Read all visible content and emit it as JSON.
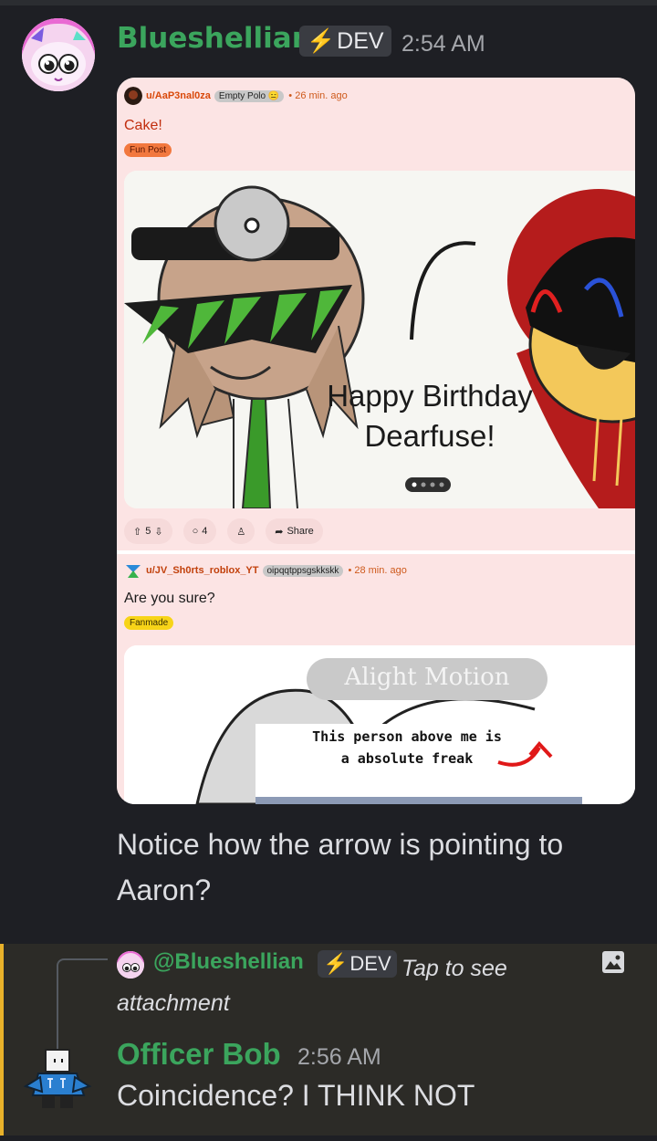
{
  "message1": {
    "author": "Blueshellian",
    "tag": "DEV",
    "time": "2:54 AM",
    "text": "Notice how the arrow is pointing to Aaron?",
    "embed": {
      "post1": {
        "user": "u/AaP3nal0za",
        "user_flair": "Empty Polo 😑",
        "age": "• 26 min. ago",
        "title": "Cake!",
        "flair": "Fun Post",
        "image_caption": "Happy Birthday Dearfuse!",
        "upvotes": "5",
        "comments": "4",
        "share": "Share"
      },
      "post2": {
        "user": "u/JV_Sh0rts_roblox_YT",
        "user_flair": "oipqqtppsgskkskk",
        "age": "• 28 min. ago",
        "title": "Are you sure?",
        "flair": "Fanmade",
        "watermark": "Alight Motion",
        "image_caption": "This person above me is a absolute freak"
      }
    }
  },
  "message2": {
    "reply_author": "@Blueshellian",
    "reply_tag": "DEV",
    "reply_text": "Tap to see attachment",
    "author": "Officer Bob",
    "time": "2:56 AM",
    "text": "Coincidence? I THINK NOT"
  },
  "colors": {
    "background": "#1e1f24",
    "name_green": "#3ba55d",
    "highlight_bar": "#e8b12a",
    "post_bg": "#fce4e4"
  },
  "icons": [
    "bolt-icon",
    "upvote-icon",
    "downvote-icon",
    "comment-icon",
    "award-icon",
    "share-icon",
    "image-icon"
  ]
}
